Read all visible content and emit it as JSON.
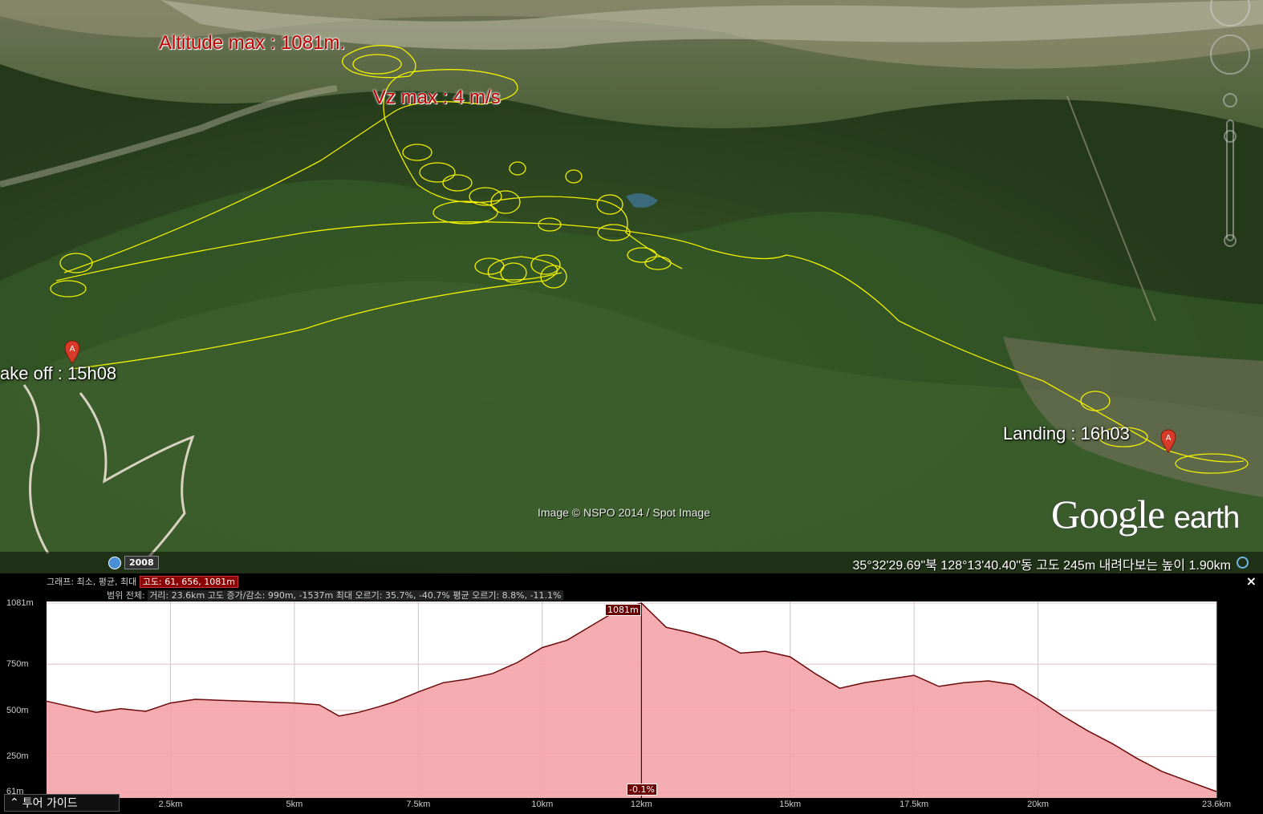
{
  "map": {
    "annotations": {
      "altitude_max": "Altitude max : 1081m.",
      "vz_max": "Vz max : 4 m/s",
      "take_off": "ake off : 15h08",
      "landing": "Landing : 16h03"
    },
    "marker_letter": "A",
    "track_color": "#f0f000",
    "image_credit": "Image © NSPO 2014 / Spot Image",
    "logo_word1": "Google",
    "logo_word2": "earth",
    "historical_year": "2008",
    "coordinates": "35°32'29.69\"북 128°13'40.40\"동 고도   245m   내려다보는 높이   1.90km"
  },
  "profile": {
    "info_line1_prefix": "그래프: 최소, 평균, 최대",
    "info_line1_values": "고도: 61, 656, 1081m",
    "info_line2_prefix": "범위 전체:",
    "info_line2_values": "거리: 23.6km 고도 증가/감소: 990m, -1537m 최대 오르기: 35.7%, -40.7% 평균 오르기: 8.8%, -11.1%",
    "close": "×",
    "peak_label": "1081m",
    "slope_label": "-0.1%",
    "cursor_distance": "12km",
    "tour_guide": "투어 가이드",
    "tour_icon": "chevron-up-icon"
  },
  "chart_data": {
    "type": "area",
    "title": "",
    "xlabel": "",
    "ylabel": "",
    "x_unit": "km",
    "y_unit": "m",
    "xlim": [
      0,
      23.6
    ],
    "ylim": [
      61,
      1081
    ],
    "y_ticks": [
      "1081m",
      "750m",
      "500m",
      "250m",
      "61m"
    ],
    "y_tick_values": [
      1081,
      750,
      500,
      250,
      61
    ],
    "x_ticks": [
      "2.5km",
      "5km",
      "7.5km",
      "10km",
      "12km",
      "15km",
      "17.5km",
      "20km",
      "23.6km"
    ],
    "x_tick_values": [
      2.5,
      5,
      7.5,
      10,
      12,
      15,
      17.5,
      20,
      23.6
    ],
    "fill_color": "#f4a3a8",
    "line_color": "#6b0a0a",
    "series": [
      {
        "x": [
          0,
          0.5,
          1.0,
          1.5,
          2.0,
          2.5,
          3.0,
          3.5,
          4.0,
          4.5,
          5.0,
          5.5,
          5.9,
          6.3,
          6.7,
          7.0,
          7.5,
          8.0,
          8.5,
          9.0,
          9.5,
          10.0,
          10.5,
          11.0,
          11.5,
          12.0,
          12.5,
          13.0,
          13.5,
          14.0,
          14.5,
          15.0,
          15.5,
          16.0,
          16.5,
          17.0,
          17.5,
          18.0,
          18.5,
          19.0,
          19.5,
          20.0,
          20.5,
          21.0,
          21.5,
          22.0,
          22.5,
          23.0,
          23.6
        ],
        "y": [
          550,
          520,
          490,
          510,
          495,
          540,
          560,
          555,
          550,
          545,
          540,
          530,
          470,
          490,
          520,
          545,
          600,
          650,
          670,
          700,
          760,
          840,
          880,
          960,
          1040,
          1081,
          950,
          920,
          880,
          810,
          820,
          790,
          700,
          620,
          650,
          670,
          690,
          630,
          650,
          660,
          640,
          560,
          470,
          390,
          320,
          240,
          170,
          120,
          61
        ]
      }
    ],
    "cursor_x": 12,
    "cursor_y": 1081
  }
}
